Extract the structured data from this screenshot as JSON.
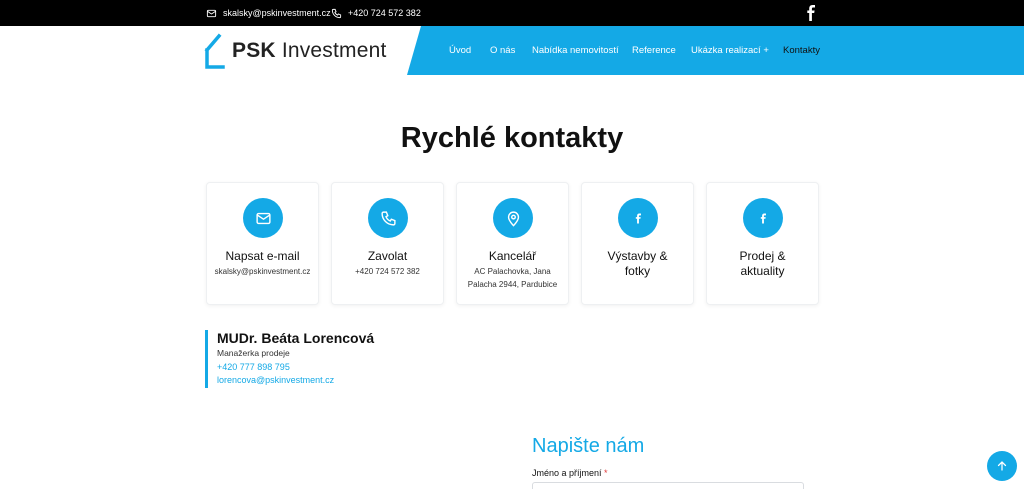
{
  "topbar": {
    "email": "skalsky@pskinvestment.cz",
    "phone": "+420 724 572 382",
    "facebook_icon": "facebook-icon"
  },
  "logo": {
    "brand_bold": "PSK",
    "brand_rest": " Investment"
  },
  "nav": {
    "items": [
      {
        "label": "Úvod"
      },
      {
        "label": "O nás"
      },
      {
        "label": "Nabídka nemovitostí"
      },
      {
        "label": "Reference"
      },
      {
        "label": "Ukázka realizací +"
      },
      {
        "label": "Kontakty"
      }
    ]
  },
  "page": {
    "title": "Rychlé kontakty"
  },
  "cards": [
    {
      "icon": "mail-icon",
      "title": "Napsat e-mail",
      "sub": "skalsky@pskinvestment.cz"
    },
    {
      "icon": "phone-icon",
      "title": "Zavolat",
      "sub": "+420 724 572 382"
    },
    {
      "icon": "location-pin-icon",
      "title": "Kancelář",
      "sub": "AC Palachovka, Jana Palacha 2944, Pardubice"
    },
    {
      "icon": "facebook-icon",
      "title": "Výstavby & fotky",
      "sub": ""
    },
    {
      "icon": "facebook-icon",
      "title": "Prodej & aktuality",
      "sub": ""
    }
  ],
  "person": {
    "name": "MUDr. Beáta Lorencová",
    "role": "Manažerka prodeje",
    "phone": "+420 777 898 795",
    "email": "lorencova@pskinvestment.cz"
  },
  "form": {
    "title": "Napište nám",
    "name_label": "Jméno a příjmení",
    "required_mark": "*"
  },
  "colors": {
    "accent": "#14a9e6",
    "topbar": "#000000",
    "text": "#111111"
  }
}
